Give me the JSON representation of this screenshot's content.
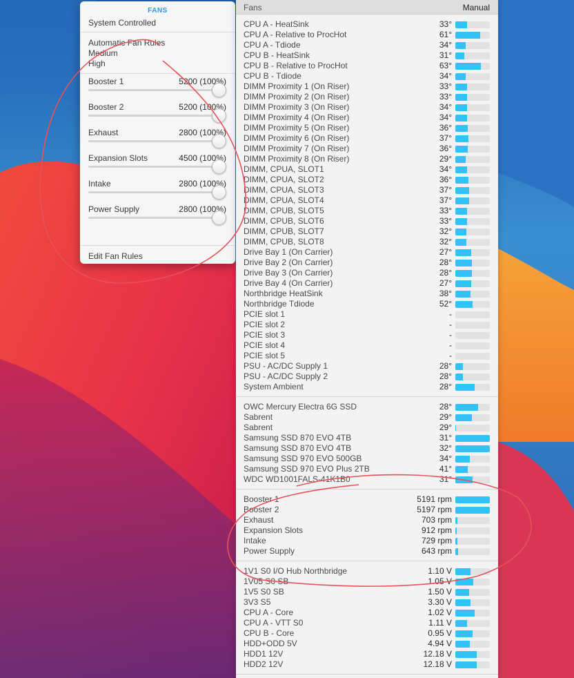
{
  "fans_menu": {
    "header": "FANS",
    "system_controlled": "System Controlled",
    "rules": [
      "Automatic Fan Rules",
      "Medium",
      "High"
    ],
    "fans": [
      {
        "name": "Booster 1",
        "value": "5200 (100%)",
        "level": 1.0
      },
      {
        "name": "Booster 2",
        "value": "5200 (100%)",
        "level": 1.0
      },
      {
        "name": "Exhaust",
        "value": "2800 (100%)",
        "level": 1.0
      },
      {
        "name": "Expansion Slots",
        "value": "4500 (100%)",
        "level": 1.0
      },
      {
        "name": "Intake",
        "value": "2800 (100%)",
        "level": 1.0
      },
      {
        "name": "Power Supply",
        "value": "2800 (100%)",
        "level": 1.0
      }
    ],
    "edit_label": "Edit Fan Rules"
  },
  "sensors": {
    "header_left": "Fans",
    "header_right": "Manual",
    "accent": "#34c1f5",
    "sections": [
      {
        "rows": [
          {
            "name": "CPU A - HeatSink",
            "value": "33°",
            "fill": 0.33
          },
          {
            "name": "CPU A - Relative to ProcHot",
            "value": "61°",
            "fill": 0.72
          },
          {
            "name": "CPU A - Tdiode",
            "value": "34°",
            "fill": 0.3
          },
          {
            "name": "CPU B - HeatSink",
            "value": "31°",
            "fill": 0.26
          },
          {
            "name": "CPU B - Relative to ProcHot",
            "value": "63°",
            "fill": 0.74
          },
          {
            "name": "CPU B - Tdiode",
            "value": "34°",
            "fill": 0.3
          },
          {
            "name": "DIMM Proximity 1 (On Riser)",
            "value": "33°",
            "fill": 0.33
          },
          {
            "name": "DIMM Proximity 2 (On Riser)",
            "value": "33°",
            "fill": 0.33
          },
          {
            "name": "DIMM Proximity 3 (On Riser)",
            "value": "34°",
            "fill": 0.34
          },
          {
            "name": "DIMM Proximity 4 (On Riser)",
            "value": "34°",
            "fill": 0.34
          },
          {
            "name": "DIMM Proximity 5 (On Riser)",
            "value": "36°",
            "fill": 0.36
          },
          {
            "name": "DIMM Proximity 6 (On Riser)",
            "value": "37°",
            "fill": 0.37
          },
          {
            "name": "DIMM Proximity 7 (On Riser)",
            "value": "36°",
            "fill": 0.36
          },
          {
            "name": "DIMM Proximity 8 (On Riser)",
            "value": "29°",
            "fill": 0.29
          },
          {
            "name": "DIMM, CPUA, SLOT1",
            "value": "34°",
            "fill": 0.34
          },
          {
            "name": "DIMM, CPUA, SLOT2",
            "value": "36°",
            "fill": 0.38
          },
          {
            "name": "DIMM, CPUA, SLOT3",
            "value": "37°",
            "fill": 0.4
          },
          {
            "name": "DIMM, CPUA, SLOT4",
            "value": "37°",
            "fill": 0.4
          },
          {
            "name": "DIMM, CPUB, SLOT5",
            "value": "33°",
            "fill": 0.33
          },
          {
            "name": "DIMM, CPUB, SLOT6",
            "value": "33°",
            "fill": 0.33
          },
          {
            "name": "DIMM, CPUB, SLOT7",
            "value": "32°",
            "fill": 0.31
          },
          {
            "name": "DIMM, CPUB, SLOT8",
            "value": "32°",
            "fill": 0.31
          },
          {
            "name": "Drive Bay 1 (On Carrier)",
            "value": "27°",
            "fill": 0.45
          },
          {
            "name": "Drive Bay 2 (On Carrier)",
            "value": "28°",
            "fill": 0.47
          },
          {
            "name": "Drive Bay 3 (On Carrier)",
            "value": "28°",
            "fill": 0.47
          },
          {
            "name": "Drive Bay 4 (On Carrier)",
            "value": "27°",
            "fill": 0.45
          },
          {
            "name": "Northbridge HeatSink",
            "value": "38°",
            "fill": 0.43
          },
          {
            "name": "Northbridge Tdiode",
            "value": "52°",
            "fill": 0.5
          },
          {
            "name": "PCIE slot 1",
            "value": "-",
            "fill": 0
          },
          {
            "name": "PCIE slot 2",
            "value": "-",
            "fill": 0
          },
          {
            "name": "PCIE slot 3",
            "value": "-",
            "fill": 0
          },
          {
            "name": "PCIE slot 4",
            "value": "-",
            "fill": 0
          },
          {
            "name": "PCIE slot 5",
            "value": "-",
            "fill": 0
          },
          {
            "name": "PSU - AC/DC Supply 1",
            "value": "28°",
            "fill": 0.22
          },
          {
            "name": "PSU - AC/DC Supply 2",
            "value": "28°",
            "fill": 0.22
          },
          {
            "name": "System Ambient",
            "value": "28°",
            "fill": 0.56
          }
        ]
      },
      {
        "rows": [
          {
            "name": "OWC Mercury Electra 6G SSD",
            "value": "28°",
            "fill": 0.66
          },
          {
            "name": "Sabrent",
            "value": "29°",
            "fill": 0.48
          },
          {
            "name": "Sabrent",
            "value": "29°",
            "fill": 0.02
          },
          {
            "name": "Samsung SSD 870 EVO 4TB",
            "value": "31°",
            "fill": 1.0
          },
          {
            "name": "Samsung SSD 870 EVO 4TB",
            "value": "32°",
            "fill": 1.0
          },
          {
            "name": "Samsung SSD 970 EVO 500GB",
            "value": "34°",
            "fill": 0.42
          },
          {
            "name": "Samsung SSD 970 EVO Plus 2TB",
            "value": "41°",
            "fill": 0.36
          },
          {
            "name": "WDC WD1001FALS-41K1B0",
            "value": "31°",
            "fill": 0.5
          }
        ]
      },
      {
        "rows": [
          {
            "name": "Booster 1",
            "value": "5191 rpm",
            "fill": 1.0
          },
          {
            "name": "Booster 2",
            "value": "5197 rpm",
            "fill": 1.0
          },
          {
            "name": "Exhaust",
            "value": "703 rpm",
            "fill": 0.06
          },
          {
            "name": "Expansion Slots",
            "value": "912 rpm",
            "fill": 0.03
          },
          {
            "name": "Intake",
            "value": "729 rpm",
            "fill": 0.05
          },
          {
            "name": "Power Supply",
            "value": "643 rpm",
            "fill": 0.07
          }
        ]
      },
      {
        "rows": [
          {
            "name": "1V1 S0 I/O Hub Northbridge",
            "value": "1.10 V",
            "fill": 0.44
          },
          {
            "name": "1V05 S0 SB",
            "value": "1.05 V",
            "fill": 0.52
          },
          {
            "name": "1V5 S0 SB",
            "value": "1.50 V",
            "fill": 0.4
          },
          {
            "name": "3V3 S5",
            "value": "3.30 V",
            "fill": 0.44
          },
          {
            "name": "CPU A - Core",
            "value": "1.02 V",
            "fill": 0.56
          },
          {
            "name": "CPU A - VTT S0",
            "value": "1.11 V",
            "fill": 0.34
          },
          {
            "name": "CPU B - Core",
            "value": "0.95 V",
            "fill": 0.5
          },
          {
            "name": "HDD+ODD 5V",
            "value": "4.94 V",
            "fill": 0.42
          },
          {
            "name": "HDD1 12V",
            "value": "12.18 V",
            "fill": 0.62
          },
          {
            "name": "HDD2 12V",
            "value": "12.18 V",
            "fill": 0.62
          }
        ]
      }
    ]
  }
}
